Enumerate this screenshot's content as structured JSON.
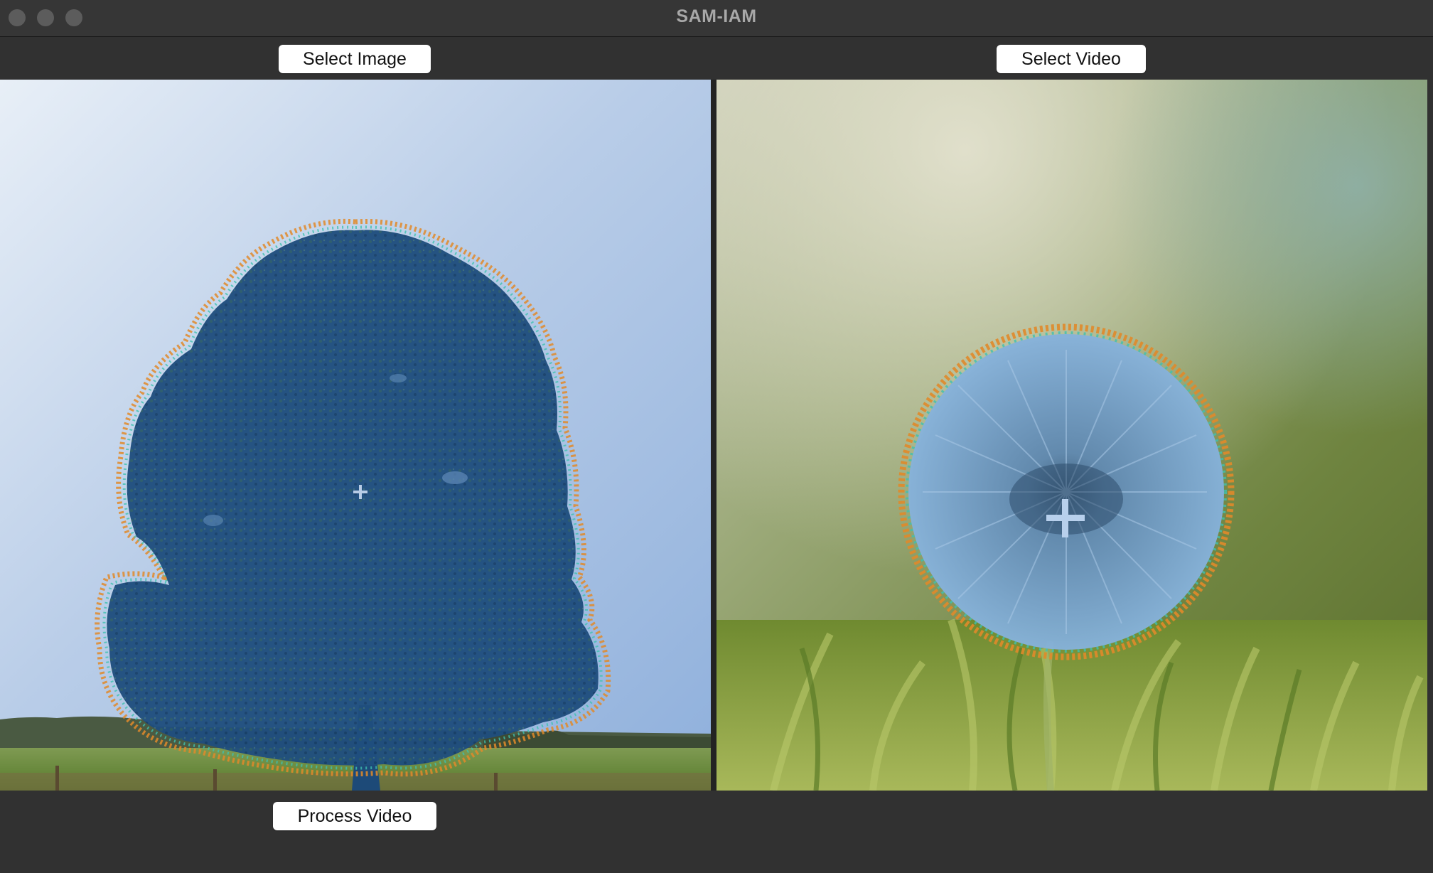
{
  "window": {
    "title": "SAM-IAM"
  },
  "toolbar": {
    "select_image_label": "Select Image",
    "select_video_label": "Select Video",
    "process_video_label": "Process Video"
  },
  "image_panel": {
    "content": "tree-photo",
    "mask_color": "#1f4f82",
    "point_marker": "plus-icon"
  },
  "video_panel": {
    "content": "dandelion-video-frame",
    "mask_color": "#7eb0e0",
    "point_marker": "plus-icon"
  },
  "colors": {
    "window_bg": "#313131",
    "titlebar_bg": "#363636",
    "button_bg": "#ffffff",
    "mask_edge_orange": "#e08a2a",
    "mask_edge_teal": "#3fc0b0"
  }
}
